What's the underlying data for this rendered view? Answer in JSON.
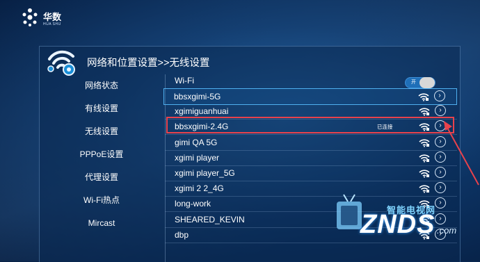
{
  "brand": {
    "name_cn": "华数",
    "name_en": "HUA SHU"
  },
  "header": {
    "title": "网络和位置设置>>无线设置"
  },
  "sidebar": {
    "items": [
      {
        "label": "网络状态"
      },
      {
        "label": "有线设置"
      },
      {
        "label": "无线设置"
      },
      {
        "label": "PPPoE设置"
      },
      {
        "label": "代理设置"
      },
      {
        "label": "Wi-Fi热点"
      },
      {
        "label": "Mircast"
      }
    ]
  },
  "wifi": {
    "label": "Wi-Fi",
    "toggle_label": "开",
    "enabled": true,
    "networks": [
      {
        "ssid": "bbsxgimi-5G",
        "status": ""
      },
      {
        "ssid": "xgimiguanhuai",
        "status": ""
      },
      {
        "ssid": "bbsxgimi-2.4G",
        "status": "已连接"
      },
      {
        "ssid": "gimi QA 5G",
        "status": ""
      },
      {
        "ssid": "xgimi player",
        "status": ""
      },
      {
        "ssid": "xgimi player_5G",
        "status": ""
      },
      {
        "ssid": "xgimi 2 2_4G",
        "status": ""
      },
      {
        "ssid": "long-work",
        "status": ""
      },
      {
        "ssid": "SHEARED_KEVIN",
        "status": ""
      },
      {
        "ssid": "dbp",
        "status": ""
      }
    ]
  },
  "watermark": {
    "sub": "智能电视网",
    "main": "ZNDS",
    "suffix": ".com"
  },
  "colors": {
    "accent": "#4fb0f0",
    "highlight": "#e8424c",
    "background": "#0d3668"
  }
}
